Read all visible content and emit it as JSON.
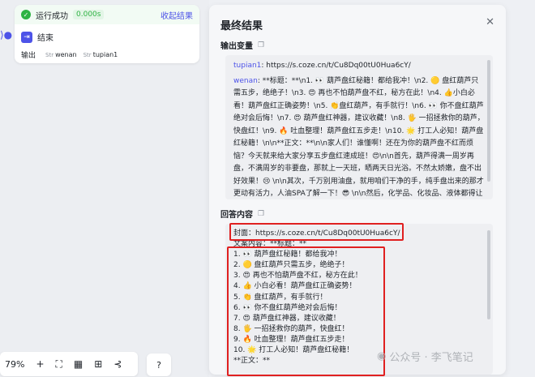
{
  "node": {
    "status": "运行成功",
    "duration": "0.000s",
    "collapse": "收起结果",
    "title": "结束",
    "output_label": "输出",
    "vars": [
      "wenan",
      "tupian1"
    ]
  },
  "toolbar": {
    "zoom": "79%"
  },
  "panel": {
    "title": "最终结果",
    "section1": "输出变量",
    "section2": "回答内容",
    "output_vars": [
      {
        "key": "tupian1",
        "value": ": https://s.coze.cn/t/Cu8Dq00tU0Hua6cY/"
      },
      {
        "key": "wenan",
        "value": ": **标题：**\\n1. 👀 葫芦盘红秘籍！都给我冲！\\n2. 🟡 盘红葫芦只需五步，绝绝子！\\n3. 😍 再也不怕葫芦盘不红，秘方在此！\\n4. 👍小白必看！葫芦盘红正确姿势！\\n5. 👏盘红葫芦，有手就行！\\n6. 👀 你不盘红葫芦绝对会后悔！\\n7. 😍 葫芦盘红神器，建议收藏！\\n8. 🖐 一招拯救你的葫芦，快盘红！\\n9. 🔥 吐血整理！葫芦盘红五步走！\\n10. 🌟 打工人必知！葫芦盘红秘籍！\\n\\n**正文：**\\n\\n家人们！谁懂啊！还在为你的葫芦盘不红而烦恼？今天就来给大家分享五步盘红速成班！😍\\n\\n首先，葫芦得满一周岁再盘，不满周岁的非要盘，那就上一天班，晒两天日光浴。不然太娇嫩，盘不出好效果！😢 \\n\\n其次，千万别用油盘，就用咱们干净的手，纯手盘出来的那才更动有活力，人油SPA了解一下！😎 \\n\\n然后，化学品、化妆品、液体都得让葫芦远离，它就是天生地长的素颜命！😄\\n\\n接着，盘的时候轻轻轻，可别大力，大力出不了奇迹，只会毁了葫芦！🙀 \\n\\n最后，每天盘半个小时，多晒太阳，红色就会慢慢到"
      }
    ],
    "answer_lines": [
      "封面：https://s.coze.cn/t/Cu8Dq00tU0Hua6cY/",
      "文案内容：**标题：**",
      "1. 👀 葫芦盘红秘籍！都给我冲！",
      "2. 🟡 盘红葫芦只需五步，绝绝子！",
      "3. 😍 再也不怕葫芦盘不红，秘方在此！",
      "4. 👍 小白必看！葫芦盘红正确姿势！",
      "5. 👏 盘红葫芦，有手就行！",
      "6. 👀 你不盘红葫芦绝对会后悔！",
      "7. 😍 葫芦盘红神器，建议收藏！",
      "8. 🖐 一招拯救你的葫芦，快盘红！",
      "9. 🔥 吐血整理！葫芦盘红五步走！",
      "10. 🌟 打工人必知！葫芦盘红秘籍！",
      "**正文：**"
    ]
  },
  "watermark": "公众号 · 李飞笔记",
  "colors": {
    "accent": "#4d53e8",
    "success": "#2fb344",
    "highlight": "#e02020"
  }
}
